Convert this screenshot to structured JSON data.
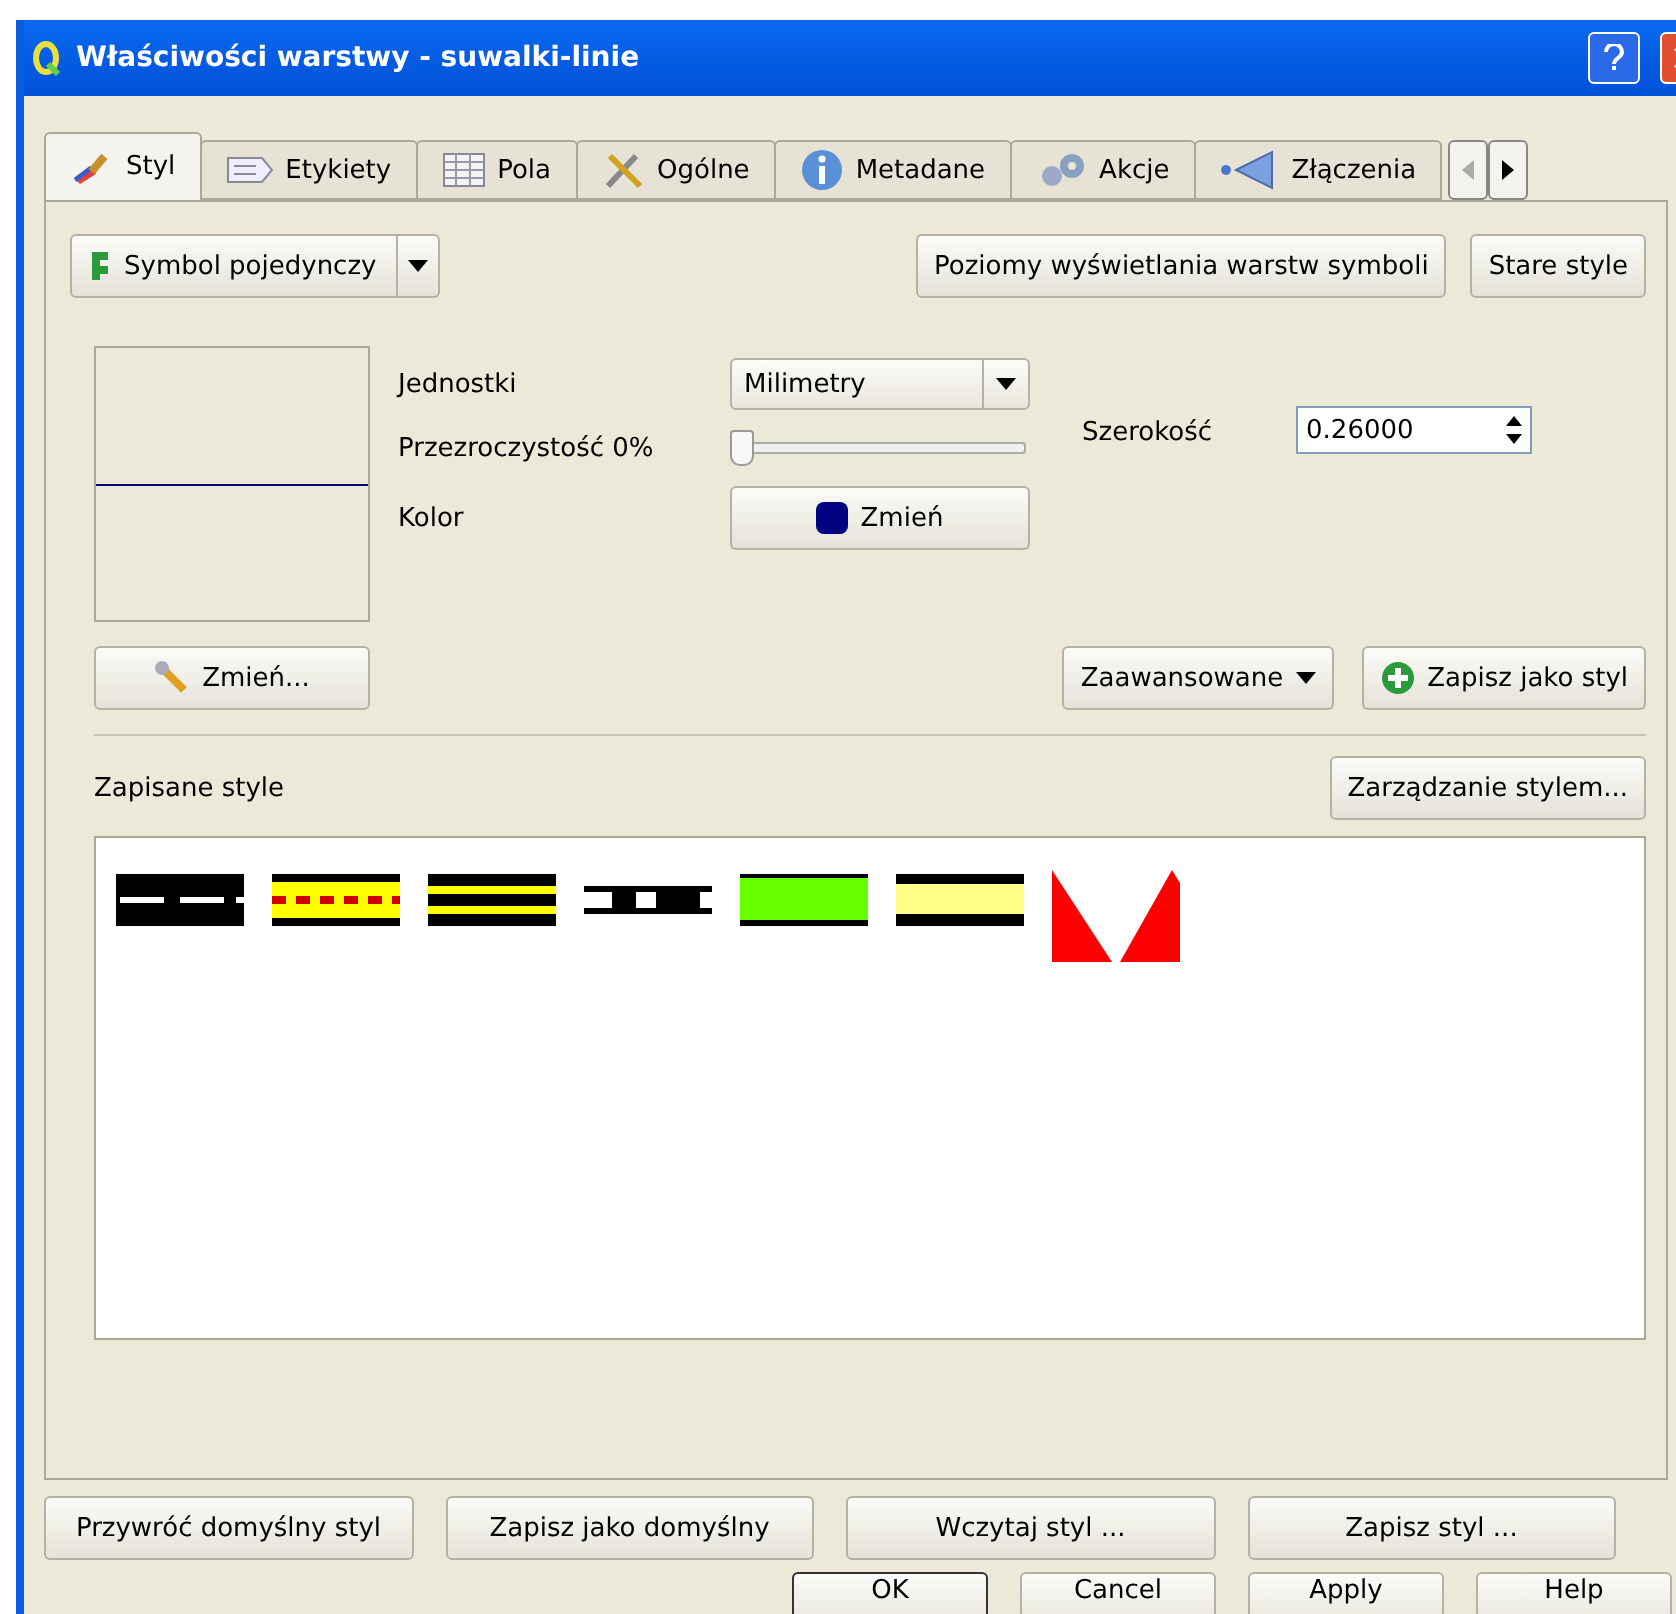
{
  "window": {
    "title": "Właściwości warstwy - suwalki-linie"
  },
  "tabs": [
    {
      "label": "Styl",
      "selected": true
    },
    {
      "label": "Etykiety",
      "selected": false
    },
    {
      "label": "Pola",
      "selected": false
    },
    {
      "label": "Ogólne",
      "selected": false
    },
    {
      "label": "Metadane",
      "selected": false
    },
    {
      "label": "Akcje",
      "selected": false
    },
    {
      "label": "Złączenia",
      "selected": false
    }
  ],
  "renderer": {
    "value": "Symbol pojedynczy"
  },
  "top_buttons": [
    "Poziomy wyświetlania warstw symboli",
    "Stare style"
  ],
  "symbol": {
    "units_label": "Jednostki",
    "units_value": "Milimetry",
    "transparency_label": "Przezroczystość 0%",
    "level": 0,
    "color_label": "Kolor",
    "color": "#000080",
    "color_button": "Zmień",
    "width_label": "Szerokość",
    "width_value": "0.26000",
    "change_button": "Zmień...",
    "advanced_button": "Zaawansowane",
    "save_style_button": "Zapisz jako styl"
  },
  "saved_styles": {
    "label": "Zapisane style",
    "manage_button": "Zarządzanie stylem...",
    "items": [
      {
        "kind": "black-dashed"
      },
      {
        "kind": "yellow-red-dashed"
      },
      {
        "kind": "black-yellow-stripes"
      },
      {
        "kind": "thin-rail"
      },
      {
        "kind": "green-band"
      },
      {
        "kind": "pale-yellow-band"
      },
      {
        "kind": "red-triangles"
      }
    ]
  },
  "bottom_buttons": [
    "Przywróć domyślny styl",
    "Zapisz jako domyślny",
    "Wczytaj styl ...",
    "Zapisz styl ..."
  ],
  "dialog_buttons": [
    "OK",
    "Cancel",
    "Apply",
    "Help"
  ]
}
